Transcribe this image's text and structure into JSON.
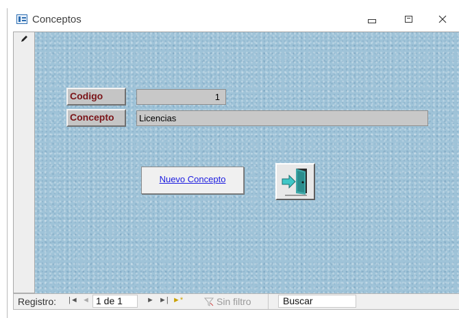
{
  "window": {
    "title": "Conceptos",
    "minimize_glyph": "▭",
    "maximize_glyph": "▣",
    "close_glyph": "☒"
  },
  "form": {
    "codigo_label": "Codigo",
    "codigo_value": "1",
    "concepto_label": "Concepto",
    "concepto_value": "Licencias",
    "nuevo_button_label": "Nuevo Concepto",
    "exit_icon": "exit-door-icon",
    "pencil_icon": "pencil-icon"
  },
  "nav": {
    "registro_label": "Registro:",
    "first_glyph": "|◄",
    "prev_glyph": "◄",
    "record_position": "1 de 1",
    "next_glyph": "►",
    "last_glyph": "►|",
    "new_glyph": "►*",
    "filter_label": "Sin filtro",
    "search_label": "Buscar"
  },
  "colors": {
    "label_text": "#7a1418",
    "form_background": "#9fc3d8",
    "link_blue": "#1a1ae0"
  }
}
